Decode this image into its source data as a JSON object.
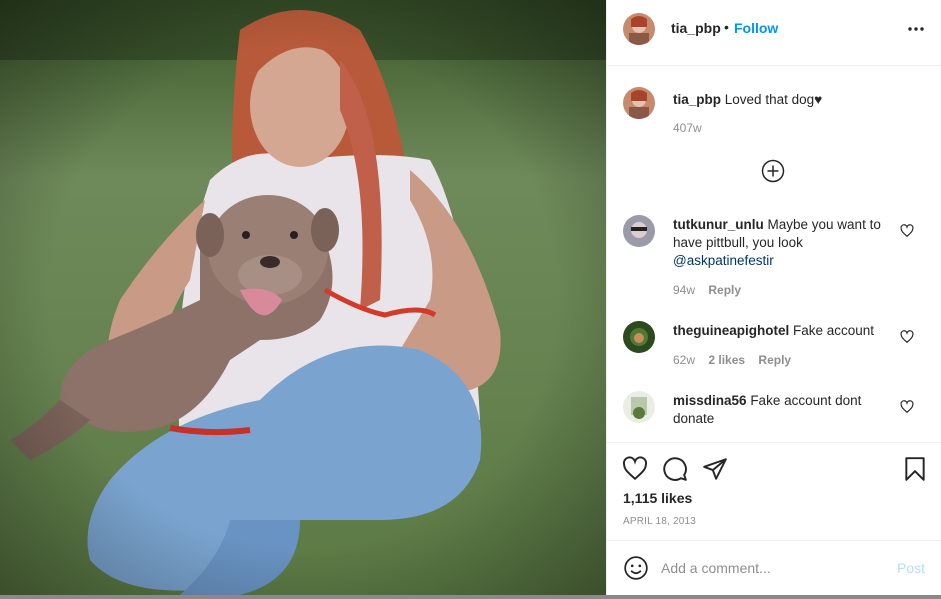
{
  "post": {
    "username": "tia_pbp",
    "follow_separator": "•",
    "follow_label": "Follow",
    "caption": {
      "username": "tia_pbp",
      "text": "Loved that dog♥",
      "age": "407w"
    },
    "comments": [
      {
        "username": "tutkunur_unlu",
        "text": "Maybe you want to have pittbull, you look ",
        "mention": "@askpatinefestir",
        "age": "94w",
        "likes": "",
        "reply_label": "Reply"
      },
      {
        "username": "theguineapighotel",
        "text": "Fake account",
        "mention": "",
        "age": "62w",
        "likes": "2 likes",
        "reply_label": "Reply"
      },
      {
        "username": "missdina56",
        "text": "Fake account dont donate",
        "mention": "",
        "age": "",
        "likes": "",
        "reply_label": ""
      }
    ],
    "likes_count": "1,115 likes",
    "date": "APRIL 18, 2013",
    "add_comment_placeholder": "Add a comment...",
    "post_button": "Post"
  },
  "icons": {
    "more": "more-horizontal-icon",
    "load_more": "plus-circle-icon",
    "like": "heart-icon",
    "comment": "comment-icon",
    "share": "paper-plane-icon",
    "save": "bookmark-icon",
    "emoji": "smiley-icon"
  },
  "colors": {
    "accent": "#0095f6",
    "text": "#262626",
    "muted": "#8e8e8e",
    "mention": "#00376b",
    "post_disabled": "#b2dffc"
  }
}
